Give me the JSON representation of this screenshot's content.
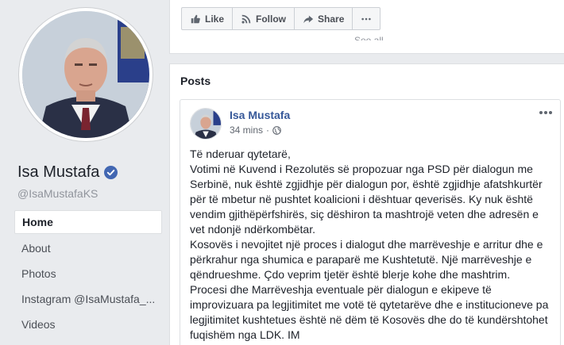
{
  "profile": {
    "name": "Isa Mustafa",
    "handle": "@IsaMustafaKS"
  },
  "nav": {
    "items": [
      {
        "label": "Home",
        "active": true
      },
      {
        "label": "About"
      },
      {
        "label": "Photos"
      },
      {
        "label": "Instagram @IsaMustafa_..."
      },
      {
        "label": "Videos"
      }
    ]
  },
  "actions": {
    "like": "Like",
    "follow": "Follow",
    "share": "Share"
  },
  "see_all": "See all",
  "posts": {
    "heading": "Posts",
    "post": {
      "author": "Isa Mustafa",
      "time": "34 mins",
      "privacy_icon": "globe-icon",
      "lines": [
        "Të nderuar qytetarë,",
        "Votimi në Kuvend i Rezolutës së propozuar nga PSD për dialogun me Serbinë, nuk është zgjidhje për dialogun por, është zgjidhje afatshkurtër për të mbetur në pushtet koalicioni i dështuar qeverisës. Ky nuk është vendim gjithëpërfshirës, siç dëshiron ta mashtrojë veten dhe adresën e vet ndonjë ndërkombëtar.",
        "Kosovës i nevojitet një proces i dialogut dhe marrëveshje e arritur dhe e përkrahur nga shumica e paraparë me Kushtetutë. Një marrëveshje e qëndrueshme. Çdo veprim tjetër është blerje kohe dhe mashtrim.",
        "Procesi dhe Marrëveshja eventuale për dialogun e ekipeve të improvizuara pa legjitimitet me votë të qytetarëve dhe e institucioneve pa legjitimitet kushtetues është në dëm të Kosovës dhe do të kundërshtohet fuqishëm nga LDK. IM"
      ]
    }
  },
  "colors": {
    "link": "#365899",
    "verified": "#4267b2",
    "page_bg": "#e9ebee"
  }
}
